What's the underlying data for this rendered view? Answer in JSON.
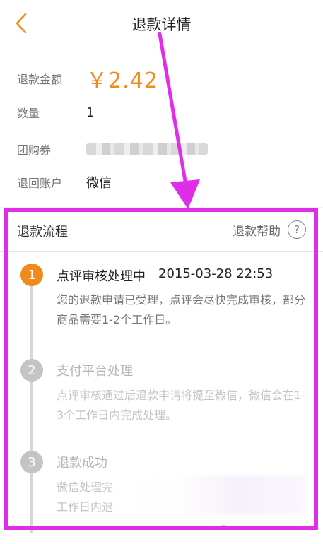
{
  "header": {
    "title": "退款详情"
  },
  "info": {
    "amount_label": "退款金额",
    "amount_value": "￥2.42",
    "quantity_label": "数量",
    "quantity_value": "1",
    "voucher_label": "团购券",
    "account_label": "退回账户",
    "account_value": "微信"
  },
  "process": {
    "title": "退款流程",
    "help_label": "退款帮助",
    "help_icon": "?",
    "steps": [
      {
        "num": "1",
        "title": "点评审核处理中",
        "time": "2015-03-28 22:53",
        "desc": "您的退款申请已受理，点评会尽快完成审核，部分商品需要1-2个工作日。"
      },
      {
        "num": "2",
        "title": "支付平台处理",
        "desc": "点评审核通过后退款申请将提至微信，微信会在1-3个工作日内完成处理。"
      },
      {
        "num": "3",
        "title": "退款成功",
        "desc_line1": "微信处理完",
        "desc_line2": "工作日内退"
      }
    ]
  },
  "colors": {
    "accent": "#f08a1c",
    "annotation": "#e02de8",
    "inactive": "#c4c4c4"
  }
}
